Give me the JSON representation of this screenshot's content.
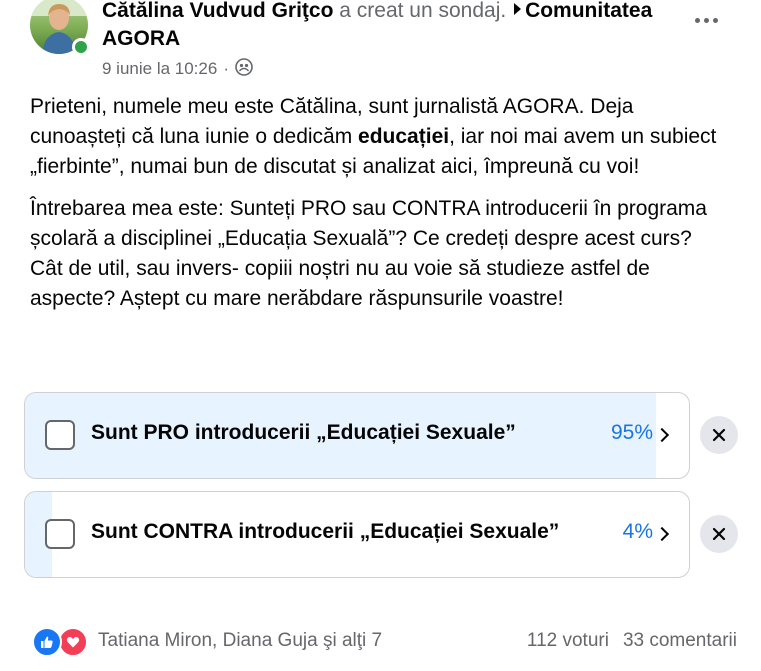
{
  "post": {
    "author": "Cătălina Vudvud Griţco",
    "action": "a creat un sondaj.",
    "group": "Comunitatea AGORA",
    "timestamp": "9 iunie la 10:26",
    "separator": "·",
    "audience_icon": "group-audience-icon",
    "paragraph1": {
      "part1": "Prieteni, numele meu este Cătălina, sunt jurnalistă AGORA. Deja cunoașteți că luna iunie o dedicăm ",
      "bold": "educației",
      "part2": ", iar noi mai avem un subiect „fierbinte”, numai bun de discutat și analizat aici, împreună cu voi!"
    },
    "paragraph2": "Întrebarea mea este: Sunteți PRO sau CONTRA introducerii în programa școlară a disciplinei „Educația Sexuală”? Ce credeți despre acest curs? Cât de util, sau invers- copiii noștri nu au voie să studieze astfel de aspecte? Aștept cu mare nerăbdare răspunsurile voastre!"
  },
  "poll": {
    "options": [
      {
        "label": "Sunt PRO introducerii „Educației Sexuale”",
        "percent_label": "95%",
        "fill_fraction": 0.95
      },
      {
        "label": "Sunt CONTRA introducerii „Educației Sexuale”",
        "percent_label": "4%",
        "fill_fraction": 0.04
      }
    ]
  },
  "footer": {
    "reactions": [
      "like-icon",
      "love-icon"
    ],
    "reactors": "Tatiana Miron, Diana Guja şi alţi 7",
    "votes": "112 voturi",
    "comments": "33 comentarii"
  },
  "colors": {
    "accent": "#1b74e4",
    "poll_fill": "#e7f3ff",
    "online": "#31a24c",
    "like": "#1877f2",
    "love": "#f33e58"
  }
}
